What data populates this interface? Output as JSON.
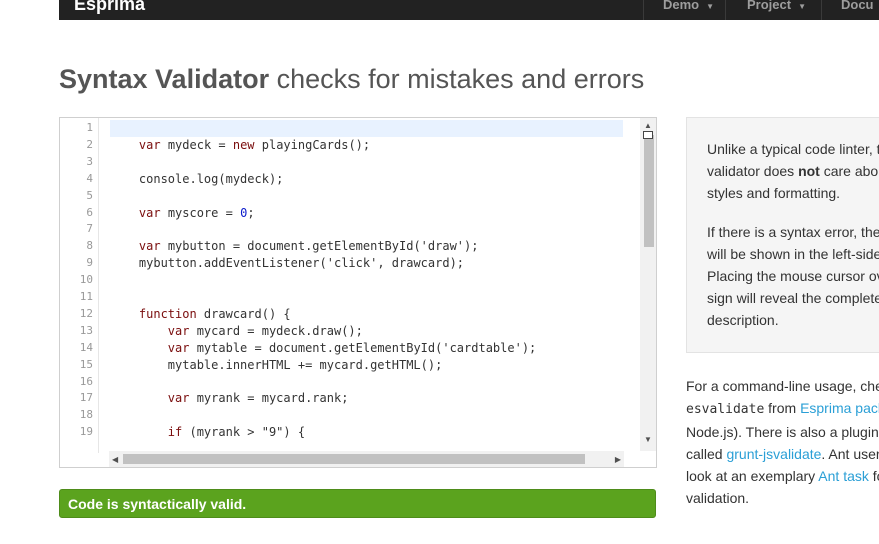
{
  "navbar": {
    "brand": "Esprima",
    "items": [
      "Demo",
      "Project",
      "Docu"
    ]
  },
  "heading": {
    "bold": "Syntax Validator",
    "rest": " checks for mistakes and errors"
  },
  "editor": {
    "line_numbers": [
      "1",
      "2",
      "3",
      "4",
      "5",
      "6",
      "7",
      "8",
      "9",
      "10",
      "11",
      "12",
      "13",
      "14",
      "15",
      "16",
      "17",
      "18",
      "19"
    ],
    "code_lines": [
      {
        "indent": "",
        "parts": []
      },
      {
        "indent": "    ",
        "parts": [
          {
            "t": "var",
            "k": "kw"
          },
          {
            "t": " mydeck = ",
            "k": ""
          },
          {
            "t": "new",
            "k": "kw"
          },
          {
            "t": " playingCards();",
            "k": ""
          }
        ]
      },
      {
        "indent": "",
        "parts": []
      },
      {
        "indent": "    ",
        "parts": [
          {
            "t": "console.log(mydeck);",
            "k": ""
          }
        ]
      },
      {
        "indent": "",
        "parts": []
      },
      {
        "indent": "    ",
        "parts": [
          {
            "t": "var",
            "k": "kw"
          },
          {
            "t": " myscore = ",
            "k": ""
          },
          {
            "t": "0",
            "k": "num"
          },
          {
            "t": ";",
            "k": ""
          }
        ]
      },
      {
        "indent": "",
        "parts": []
      },
      {
        "indent": "    ",
        "parts": [
          {
            "t": "var",
            "k": "kw"
          },
          {
            "t": " mybutton = document.getElementById('draw');",
            "k": ""
          }
        ]
      },
      {
        "indent": "    ",
        "parts": [
          {
            "t": "mybutton.addEventListener('click', drawcard);",
            "k": ""
          }
        ]
      },
      {
        "indent": "",
        "parts": []
      },
      {
        "indent": "",
        "parts": []
      },
      {
        "indent": "    ",
        "parts": [
          {
            "t": "function",
            "k": "kw"
          },
          {
            "t": " drawcard() {",
            "k": ""
          }
        ]
      },
      {
        "indent": "        ",
        "parts": [
          {
            "t": "var",
            "k": "kw"
          },
          {
            "t": " mycard = mydeck.draw();",
            "k": ""
          }
        ]
      },
      {
        "indent": "        ",
        "parts": [
          {
            "t": "var",
            "k": "kw"
          },
          {
            "t": " mytable = document.getElementById('cardtable');",
            "k": ""
          }
        ]
      },
      {
        "indent": "        ",
        "parts": [
          {
            "t": "mytable.innerHTML += mycard.getHTML();",
            "k": ""
          }
        ]
      },
      {
        "indent": "",
        "parts": []
      },
      {
        "indent": "        ",
        "parts": [
          {
            "t": "var",
            "k": "kw"
          },
          {
            "t": " myrank = mycard.rank;",
            "k": ""
          }
        ]
      },
      {
        "indent": "",
        "parts": []
      },
      {
        "indent": "        ",
        "parts": [
          {
            "t": "if",
            "k": "kw"
          },
          {
            "t": " (myrank > \"9\") {",
            "k": ""
          }
        ]
      }
    ]
  },
  "status": "Code is syntactically valid.",
  "infobox": {
    "lines": [
      {
        "text": "Unlike a typical code linter, t"
      },
      {
        "pre": "validator does ",
        "bold": "not",
        "post": " care abo"
      },
      {
        "text": "styles and formatting."
      },
      {
        "text": "If there is a syntax error, the"
      },
      {
        "text": "will be shown in the left-side"
      },
      {
        "text": "Placing the mouse cursor ov"
      },
      {
        "text": "sign will reveal the complete"
      },
      {
        "text": "description."
      }
    ]
  },
  "cli": {
    "l1": "For a command-line usage, che",
    "l2_code": "esvalidate",
    "l2_text": " from ",
    "l2_link": "Esprima pack",
    "l3": "Node.js). There is also a plugin",
    "l4_pre": "called ",
    "l4_link": "grunt-jsvalidate",
    "l4_post": ". Ant user",
    "l5_pre": "look at an exemplary ",
    "l5_link": "Ant task",
    "l5_post": " fo",
    "l6": "validation."
  },
  "colors": {
    "navbar": "#222222",
    "status": "#5ba31e",
    "link": "#2a9fd6",
    "keyword": "#7a0d0d",
    "number": "#0b1bcb"
  }
}
